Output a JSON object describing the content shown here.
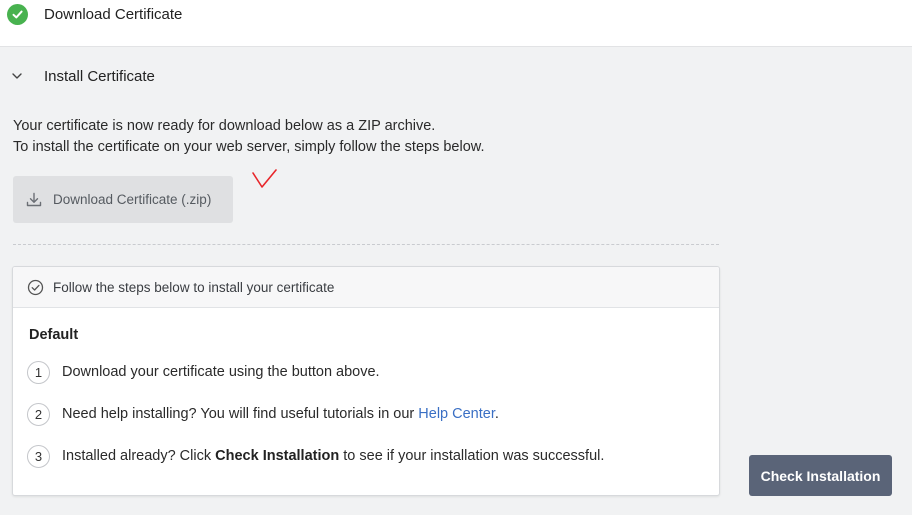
{
  "step_download": {
    "title": "Download Certificate",
    "status_icon": "check-circle-icon",
    "status_color": "#48b24f"
  },
  "step_install": {
    "title": "Install Certificate",
    "intro_line1": "Your certificate is now ready for download below as a ZIP archive.",
    "intro_line2": "To install the certificate on your web server, simply follow the steps below.",
    "download_button": "Download Certificate (.zip)"
  },
  "instructions": {
    "header": "Follow the steps below to install your certificate",
    "group_label": "Default",
    "steps": [
      {
        "number": "1",
        "text": "Download your certificate using the button above."
      },
      {
        "number": "2",
        "text_before": "Need help installing? You will find useful tutorials in our ",
        "link": "Help Center",
        "text_after": "."
      },
      {
        "number": "3",
        "text_before": "Installed already? Click ",
        "strong": "Check Installation",
        "text_after": " to see if your installation was successful."
      }
    ]
  },
  "check_installation_button": "Check Installation",
  "colors": {
    "accent_button": "#5a6478",
    "link": "#3a6fc4",
    "annotation_mark": "#e8262a"
  }
}
